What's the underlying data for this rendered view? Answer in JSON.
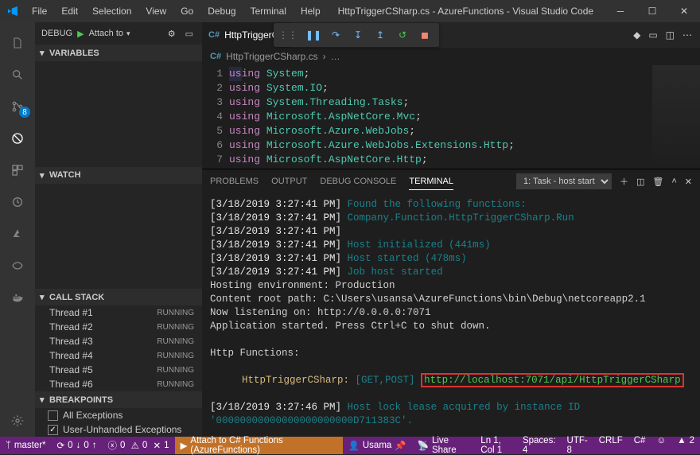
{
  "window": {
    "title": "HttpTriggerCSharp.cs - AzureFunctions - Visual Studio Code",
    "menu": [
      "File",
      "Edit",
      "Selection",
      "View",
      "Go",
      "Debug",
      "Terminal",
      "Help"
    ]
  },
  "activitybar": {
    "scm_badge": "8"
  },
  "debug": {
    "label": "DEBUG",
    "config_name": "Attach to",
    "sections": {
      "variables": "VARIABLES",
      "watch": "WATCH",
      "callstack": "CALL STACK",
      "breakpoints": "BREAKPOINTS"
    },
    "callstack_state": "RUNNING",
    "threads": [
      "Thread #1",
      "Thread #2",
      "Thread #3",
      "Thread #4",
      "Thread #5",
      "Thread #6"
    ],
    "breakpoints": [
      {
        "label": "All Exceptions",
        "checked": false
      },
      {
        "label": "User-Unhandled Exceptions",
        "checked": true
      }
    ]
  },
  "editor": {
    "tabs": [
      {
        "lang": "C#",
        "name": "HttpTriggerCS"
      }
    ],
    "breadcrumb": [
      {
        "lang": "C#",
        "name": "HttpTriggerCSharp.cs"
      },
      {
        "name": "…"
      }
    ],
    "code": [
      {
        "n": "1",
        "kw": "using",
        "ns": "System",
        "tail": ";"
      },
      {
        "n": "2",
        "kw": "using",
        "ns": "System.IO",
        "tail": ";"
      },
      {
        "n": "3",
        "kw": "using",
        "ns": "System.Threading.Tasks",
        "tail": ";"
      },
      {
        "n": "4",
        "kw": "using",
        "ns": "Microsoft.AspNetCore.Mvc",
        "tail": ";"
      },
      {
        "n": "5",
        "kw": "using",
        "ns": "Microsoft.Azure.WebJobs",
        "tail": ";"
      },
      {
        "n": "6",
        "kw": "using",
        "ns": "Microsoft.Azure.WebJobs.Extensions.Http",
        "tail": ";"
      },
      {
        "n": "7",
        "kw": "using",
        "ns": "Microsoft.AspNetCore.Http",
        "tail": ";"
      }
    ]
  },
  "panel": {
    "tabs": [
      "PROBLEMS",
      "OUTPUT",
      "DEBUG CONSOLE",
      "TERMINAL"
    ],
    "active_tab": "TERMINAL",
    "dropdown": "1: Task - host start",
    "terminal_lines": [
      {
        "ts": "[3/18/2019 3:27:41 PM]",
        "msg": "Found the following functions:",
        "cls": "msg-green"
      },
      {
        "ts": "[3/18/2019 3:27:41 PM]",
        "msg": "Company.Function.HttpTriggerCSharp.Run",
        "cls": "msg-green"
      },
      {
        "ts": "[3/18/2019 3:27:41 PM]",
        "msg": "",
        "cls": ""
      },
      {
        "ts": "[3/18/2019 3:27:41 PM]",
        "msg": "Host initialized (441ms)",
        "cls": "msg-green"
      },
      {
        "ts": "[3/18/2019 3:27:41 PM]",
        "msg": "Host started (478ms)",
        "cls": "msg-green"
      },
      {
        "ts": "[3/18/2019 3:27:41 PM]",
        "msg": "Job host started",
        "cls": "msg-green"
      }
    ],
    "plain_lines": [
      "Hosting environment: Production",
      "Content root path: C:\\Users\\usansa\\AzureFunctions\\bin\\Debug\\netcoreapp2.1",
      "Now listening on: http://0.0.0.0:7071",
      "Application started. Press Ctrl+C to shut down.",
      "",
      "Http Functions:",
      ""
    ],
    "http_fn": {
      "name": "HttpTriggerCSharp:",
      "methods": "[GET,POST]",
      "url": "http://localhost:7071/api/HttpTriggerCSharp"
    },
    "trailer_ts": "[3/18/2019 3:27:46 PM]",
    "trailer_msg": "Host lock lease acquired by instance ID '00000000000000000000000D711383C'."
  },
  "status": {
    "branch": "master*",
    "sync_down": "0",
    "sync_up": "0",
    "errors": "0",
    "warnings": "0",
    "times": "1",
    "debug_target": "Attach to C# Functions (AzureFunctions)",
    "user": "Usama",
    "liveshare": "Live Share",
    "ln": "Ln 1, Col 1",
    "spaces": "Spaces: 4",
    "encoding": "UTF-8",
    "eol": "CRLF",
    "lang": "C#",
    "problems": "2"
  }
}
